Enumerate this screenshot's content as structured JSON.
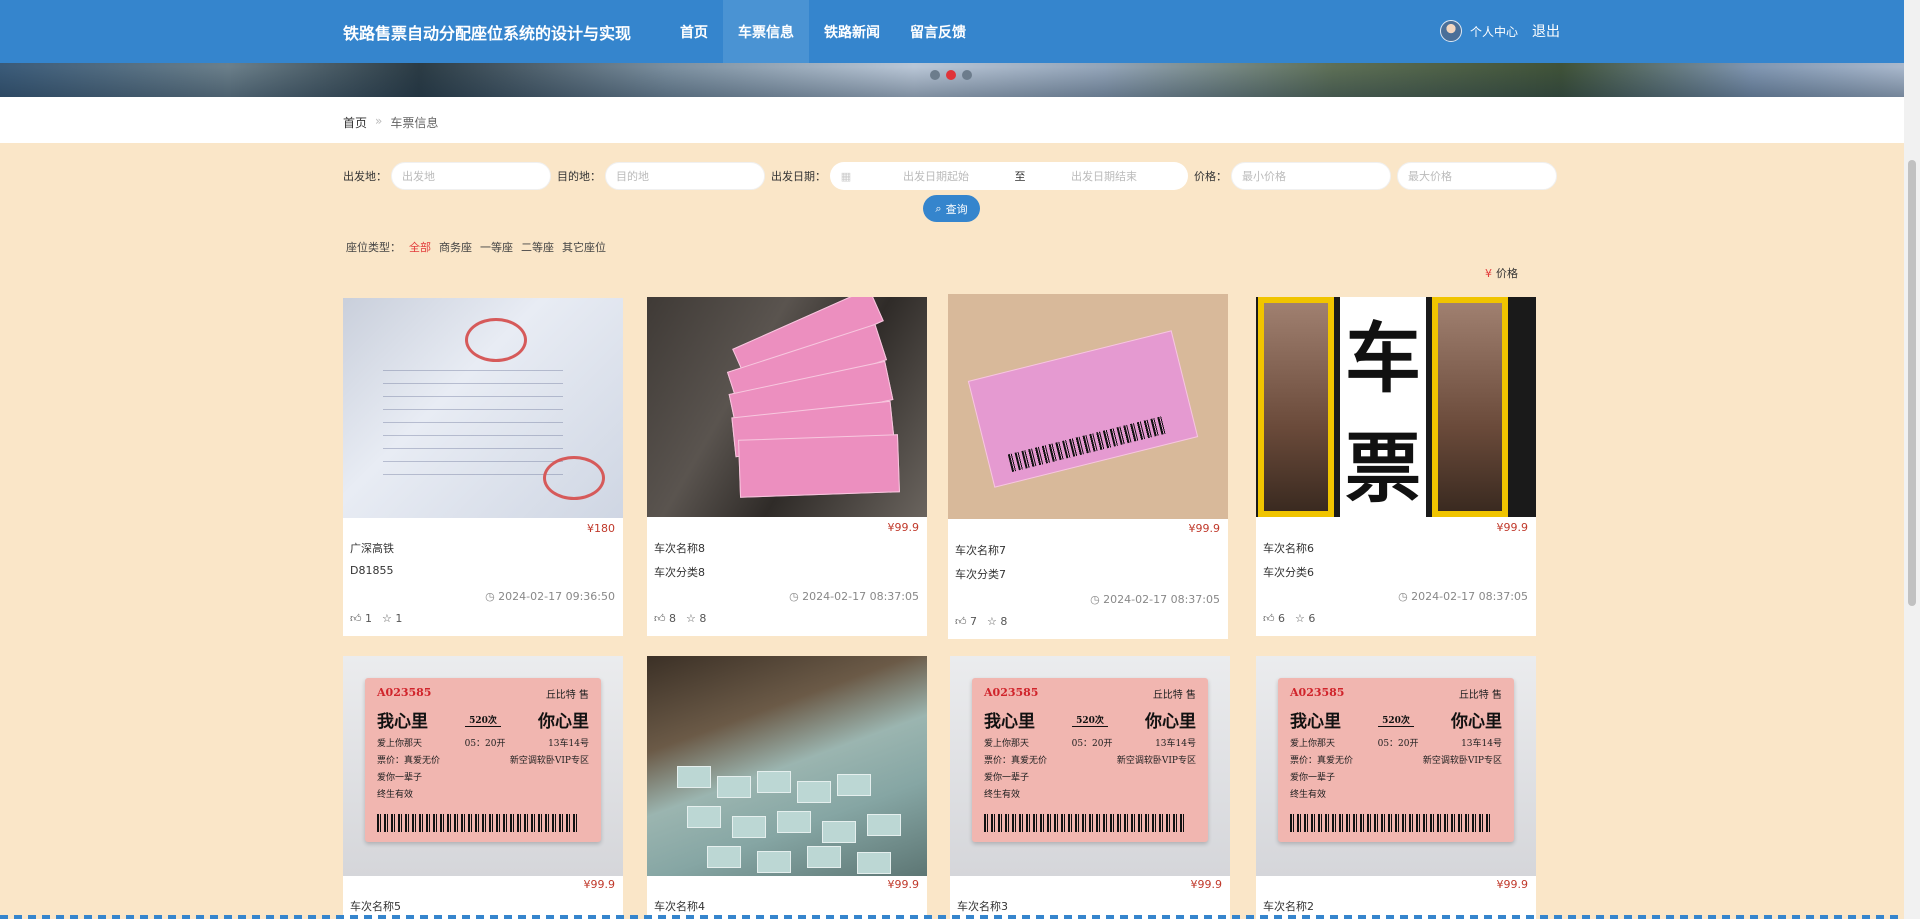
{
  "header": {
    "site_title": "铁路售票自动分配座位系统的设计与实现",
    "nav": [
      "首页",
      "车票信息",
      "铁路新闻",
      "留言反馈"
    ],
    "active_nav": "车票信息",
    "user_center": "个人中心",
    "logout": "退出"
  },
  "breadcrumb": {
    "home": "首页",
    "sep": "»",
    "current": "车票信息"
  },
  "search": {
    "departure_label": "出发地：",
    "departure_placeholder": "出发地",
    "destination_label": "目的地：",
    "destination_placeholder": "目的地",
    "date_label": "出发日期：",
    "date_start_placeholder": "出发日期起始",
    "date_to": "至",
    "date_end_placeholder": "出发日期结束",
    "price_label": "价格：",
    "price_min_placeholder": "最小价格",
    "price_max_placeholder": "最大价格",
    "button": "查询"
  },
  "filter": {
    "label": "座位类型：",
    "options": [
      "全部",
      "商务座",
      "一等座",
      "二等座",
      "其它座位"
    ],
    "active": "全部"
  },
  "sort": {
    "symbol": "¥",
    "label": "价格"
  },
  "cards": [
    {
      "price": "¥180",
      "name": "广深高铁",
      "sub": "D81855",
      "time": "2024-02-17 09:36:50",
      "likes": "1",
      "favs": "1"
    },
    {
      "price": "¥99.9",
      "name": "车次名称8",
      "sub": "车次分类8",
      "time": "2024-02-17 08:37:05",
      "likes": "8",
      "favs": "8"
    },
    {
      "price": "¥99.9",
      "name": "车次名称7",
      "sub": "车次分类7",
      "time": "2024-02-17 08:37:05",
      "likes": "7",
      "favs": "8"
    },
    {
      "price": "¥99.9",
      "name": "车次名称6",
      "sub": "车次分类6",
      "time": "2024-02-17 08:37:05",
      "likes": "6",
      "favs": "6"
    },
    {
      "price": "¥99.9",
      "name": "车次名称5"
    },
    {
      "price": "¥99.9",
      "name": "车次名称4"
    },
    {
      "price": "¥99.9",
      "name": "车次名称3"
    },
    {
      "price": "¥99.9",
      "name": "车次名称2"
    }
  ],
  "images": {
    "rail_text": [
      "车",
      "票"
    ],
    "love_ticket": {
      "code": "A023585",
      "brand": "丘比特 售",
      "from": "我心里",
      "train": "520次",
      "to": "你心里",
      "row1_left": "爱上你那天",
      "row1_mid": "05：20开",
      "row1_right": "13车14号",
      "row2_left": "票价：真爱无价",
      "row2_right": "新空调软卧VIP专区",
      "row3": "爱你一辈子",
      "row4": "终生有效"
    }
  },
  "colors": {
    "header": "#3585cd",
    "page_bg": "#fae6c8",
    "price": "#c0392b",
    "accent_red": "#e23b3b"
  }
}
